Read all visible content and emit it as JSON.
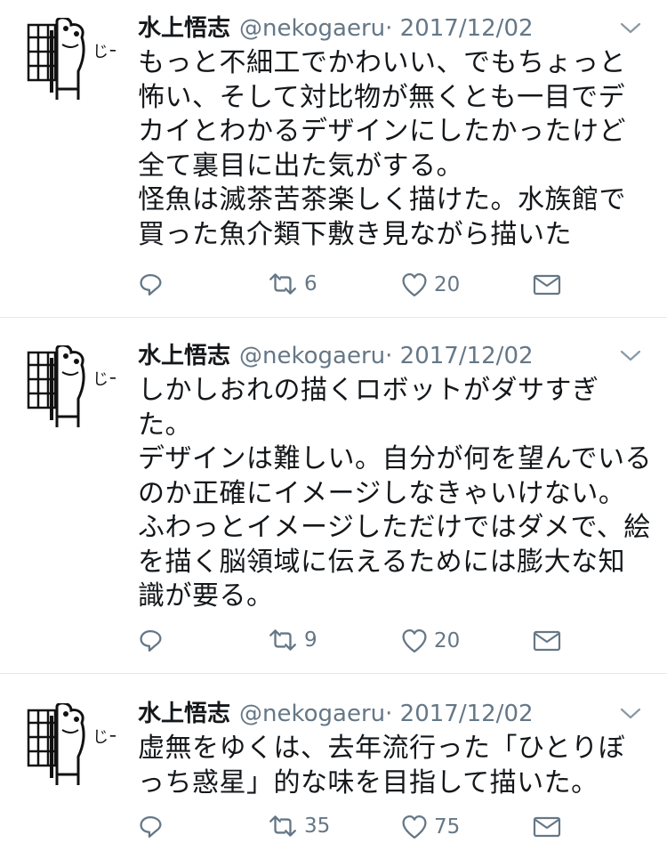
{
  "tweets": [
    {
      "author_name": "水上悟志",
      "author_handle": "@nekogaeru",
      "separator": "·",
      "date": "2017/12/02",
      "text": "もっと不細工でかわいい、でもちょっと\n怖い、そして対比物が無くとも一目でデ\nカイとわかるデザインにしたかったけど\n全て裏目に出た気がする。\n怪魚は滅茶苦茶楽しく描けた。水族館で\n買った魚介類下敷き見ながら描いた",
      "retweets": "6",
      "likes": "20"
    },
    {
      "author_name": "水上悟志",
      "author_handle": "@nekogaeru",
      "separator": "·",
      "date": "2017/12/02",
      "text": "しかしおれの描くロボットがダサすぎ\nた。\nデザインは難しい。自分が何を望んでいる\nのか正確にイメージしなきゃいけない。\nふわっとイメージしただけではダメで、絵\nを描く脳領域に伝えるためには膨大な知\n識が要る。",
      "retweets": "9",
      "likes": "20"
    },
    {
      "author_name": "水上悟志",
      "author_handle": "@nekogaeru",
      "separator": "·",
      "date": "2017/12/02",
      "text": "虚無をゆくは、去年流行った「ひとりぼ\nっち惑星」的な味を目指して描いた。",
      "retweets": "35",
      "likes": "75"
    }
  ],
  "avatar_text": "じー",
  "icons": {
    "reply": "reply-icon",
    "retweet": "retweet-icon",
    "like": "heart-icon",
    "dm": "envelope-icon",
    "more": "chevron-down-icon"
  },
  "colors": {
    "text": "#14171a",
    "secondary": "#657786",
    "divider": "#e1e8ed"
  }
}
